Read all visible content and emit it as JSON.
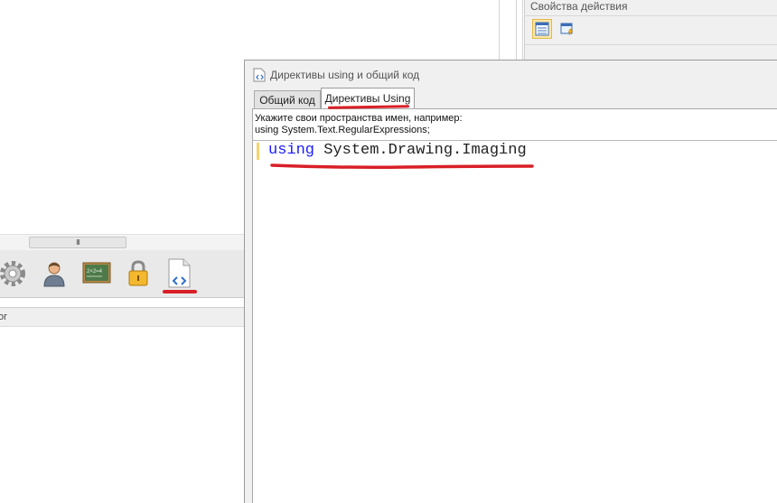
{
  "properties_panel": {
    "title": "Свойства действия"
  },
  "background": {
    "bottom_header_text": "ог",
    "splitter_grip": "III"
  },
  "toolbar": {
    "icons": [
      "gear-icon",
      "user-icon",
      "chalkboard-icon",
      "lock-icon",
      "code-file-icon"
    ]
  },
  "dialog": {
    "title": "Директивы using и общий код",
    "tabs": [
      {
        "label": "Общий код"
      },
      {
        "label": "Директивы Using"
      }
    ],
    "hint_line1": "Укажите свои пространства имен, например:",
    "hint_line2": "using System.Text.RegularExpressions;",
    "code": {
      "keyword": "using",
      "namespace": " System.Drawing.Imaging"
    }
  },
  "colors": {
    "annotation_red": "#d91f26",
    "keyword_blue": "#1a1aff",
    "active_button": "#fbe6a6"
  }
}
